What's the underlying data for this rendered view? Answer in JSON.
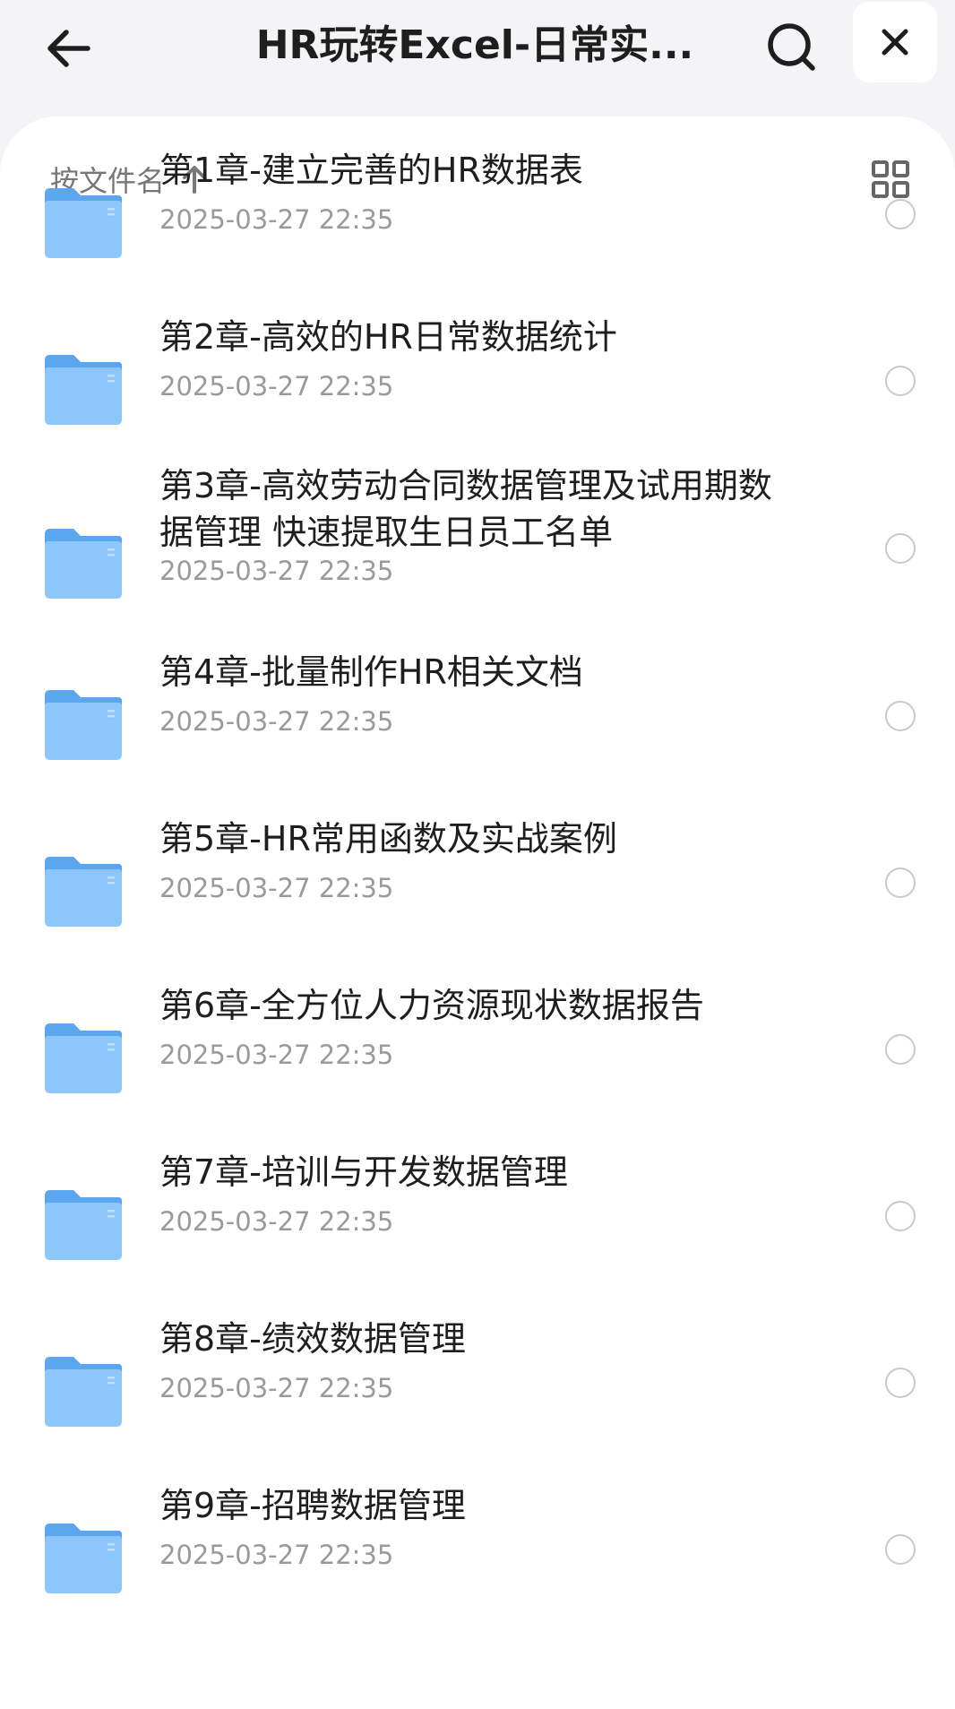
{
  "header": {
    "title": "HR玩转Excel-日常实...",
    "back_icon": "arrow-left-icon",
    "search_icon": "search-icon",
    "close_icon": "close-icon"
  },
  "toolbar": {
    "sort_label": "按文件名",
    "sort_icon": "arrow-up-icon",
    "view_icon": "grid-view-icon"
  },
  "files": [
    {
      "name": "第1章-建立完善的HR数据表",
      "date": "2025-03-27 22:35"
    },
    {
      "name": "第2章-高效的HR日常数据统计",
      "date": "2025-03-27 22:35"
    },
    {
      "name": "第3章-高效劳动合同数据管理及试用期数据管理 快速提取生日员工名单",
      "date": "2025-03-27 22:35"
    },
    {
      "name": "第4章-批量制作HR相关文档",
      "date": "2025-03-27 22:35"
    },
    {
      "name": "第5章-HR常用函数及实战案例",
      "date": "2025-03-27 22:35"
    },
    {
      "name": "第6章-全方位人力资源现状数据报告",
      "date": "2025-03-27 22:35"
    },
    {
      "name": "第7章-培训与开发数据管理",
      "date": "2025-03-27 22:35"
    },
    {
      "name": "第8章-绩效数据管理",
      "date": "2025-03-27 22:35"
    },
    {
      "name": "第9章-招聘数据管理",
      "date": "2025-03-27 22:35"
    }
  ],
  "colors": {
    "folder_back": "#5aa7f0",
    "folder_front": "#8cc6fa",
    "text_primary": "#1e1e1e",
    "text_secondary": "#9a9a9a",
    "background": "#f4f4f6"
  }
}
